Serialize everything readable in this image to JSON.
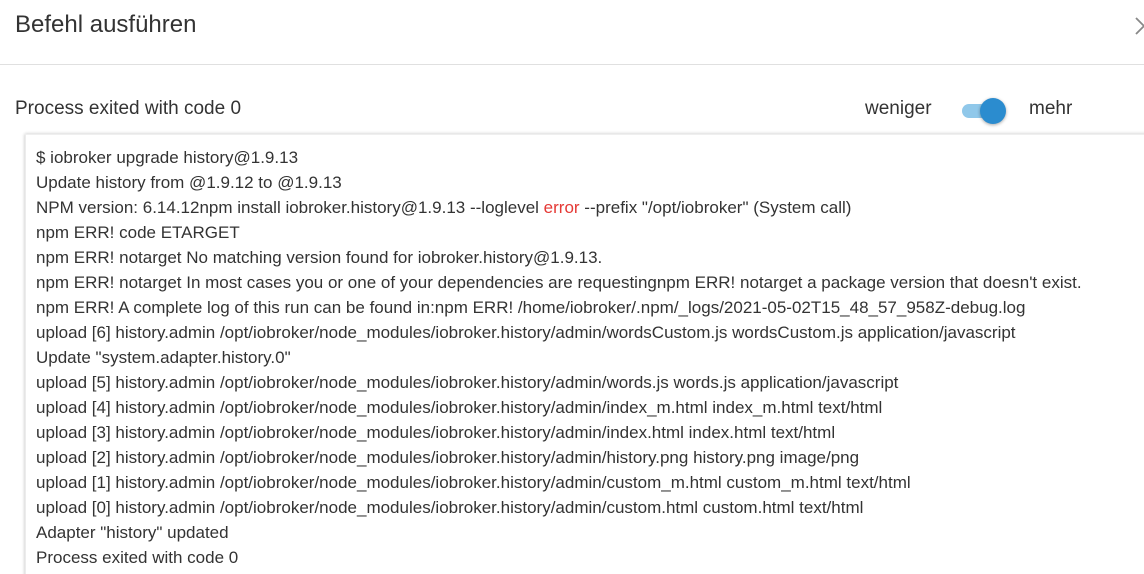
{
  "dialog": {
    "title": "Befehl ausführen",
    "close_icon": "chevron-right-icon"
  },
  "status": {
    "text": "Process exited with code 0"
  },
  "toggle": {
    "label_less": "weniger",
    "label_more": "mehr",
    "state": "on",
    "track_color": "#90c8ea",
    "thumb_color": "#2b8ccf"
  },
  "log": {
    "error_color": "#e53935",
    "lines": [
      "$ iobroker upgrade history@1.9.13",
      "Update history from @1.9.12 to @1.9.13",
      {
        "before": "NPM version: 6.14.12npm install iobroker.history@1.9.13 --loglevel ",
        "highlight": "error",
        "after": " --prefix \"/opt/iobroker\" (System call)"
      },
      "npm ERR! code ETARGET",
      "npm ERR! notarget No matching version found for iobroker.history@1.9.13.",
      "npm ERR! notarget In most cases you or one of your dependencies are requestingnpm ERR! notarget a package version that doesn't exist.",
      "npm ERR! A complete log of this run can be found in:npm ERR! /home/iobroker/.npm/_logs/2021-05-02T15_48_57_958Z-debug.log",
      "upload [6] history.admin /opt/iobroker/node_modules/iobroker.history/admin/wordsCustom.js wordsCustom.js application/javascript",
      "Update \"system.adapter.history.0\"",
      "upload [5] history.admin /opt/iobroker/node_modules/iobroker.history/admin/words.js words.js application/javascript",
      "upload [4] history.admin /opt/iobroker/node_modules/iobroker.history/admin/index_m.html index_m.html text/html",
      "upload [3] history.admin /opt/iobroker/node_modules/iobroker.history/admin/index.html index.html text/html",
      "upload [2] history.admin /opt/iobroker/node_modules/iobroker.history/admin/history.png history.png image/png",
      "upload [1] history.admin /opt/iobroker/node_modules/iobroker.history/admin/custom_m.html custom_m.html text/html",
      "upload [0] history.admin /opt/iobroker/node_modules/iobroker.history/admin/custom.html custom.html text/html",
      "Adapter \"history\" updated",
      "Process exited with code 0"
    ]
  }
}
